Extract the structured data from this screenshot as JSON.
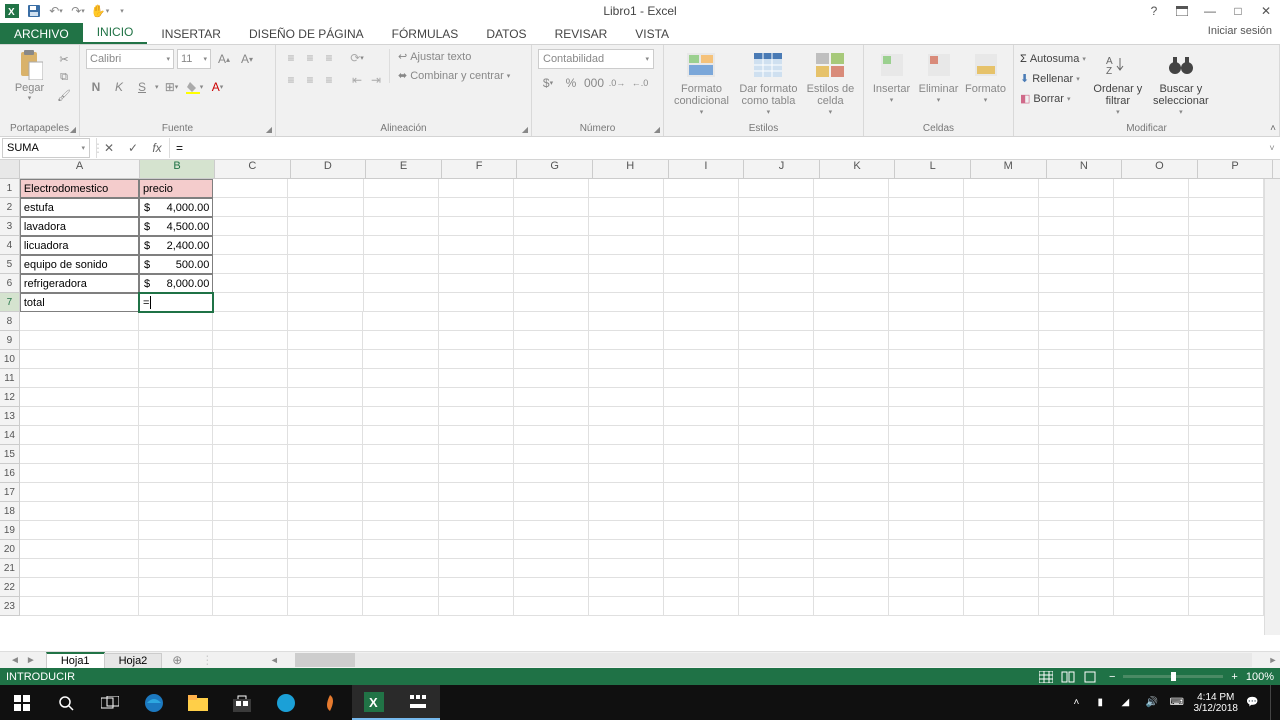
{
  "title": "Libro1 - Excel",
  "signin": "Iniciar sesión",
  "tabs": {
    "file": "ARCHIVO",
    "home": "INICIO",
    "insert": "INSERTAR",
    "page": "DISEÑO DE PÁGINA",
    "formulas": "FÓRMULAS",
    "data": "DATOS",
    "review": "REVISAR",
    "view": "VISTA"
  },
  "ribbon": {
    "clipboard": {
      "label": "Portapapeles",
      "paste": "Pegar"
    },
    "font": {
      "label": "Fuente",
      "name": "Calibri",
      "size": "11"
    },
    "align": {
      "label": "Alineación",
      "wrap": "Ajustar texto",
      "merge": "Combinar y centrar"
    },
    "number": {
      "label": "Número",
      "format": "Contabilidad"
    },
    "styles": {
      "label": "Estilos",
      "cond": "Formato condicional",
      "table": "Dar formato como tabla",
      "cell": "Estilos de celda"
    },
    "cells": {
      "label": "Celdas",
      "insert": "Insertar",
      "delete": "Eliminar",
      "format": "Formato"
    },
    "editing": {
      "label": "Modificar",
      "sum": "Autosuma",
      "fill": "Rellenar",
      "clear": "Borrar",
      "sort": "Ordenar y filtrar",
      "find": "Buscar y seleccionar"
    }
  },
  "name_box": "SUMA",
  "formula": "=",
  "columns": [
    "A",
    "B",
    "C",
    "D",
    "E",
    "F",
    "G",
    "H",
    "I",
    "J",
    "K",
    "L",
    "M",
    "N",
    "O",
    "P"
  ],
  "headers": {
    "A": "Electrodomestico",
    "B": "precio"
  },
  "data_rows": [
    {
      "A": "estufa",
      "B_cur": "$",
      "B_val": "4,000.00"
    },
    {
      "A": "lavadora",
      "B_cur": "$",
      "B_val": "4,500.00"
    },
    {
      "A": "licuadora",
      "B_cur": "$",
      "B_val": "2,400.00"
    },
    {
      "A": "equipo de sonido",
      "B_cur": "$",
      "B_val": "500.00"
    },
    {
      "A": "refrigeradora",
      "B_cur": "$",
      "B_val": "8,000.00"
    }
  ],
  "total_label": "total",
  "edit_value": "=",
  "sheets": {
    "s1": "Hoja1",
    "s2": "Hoja2"
  },
  "status": "INTRODUCIR",
  "zoom": "100%",
  "clock": {
    "time": "4:14 PM",
    "date": "3/12/2018"
  }
}
